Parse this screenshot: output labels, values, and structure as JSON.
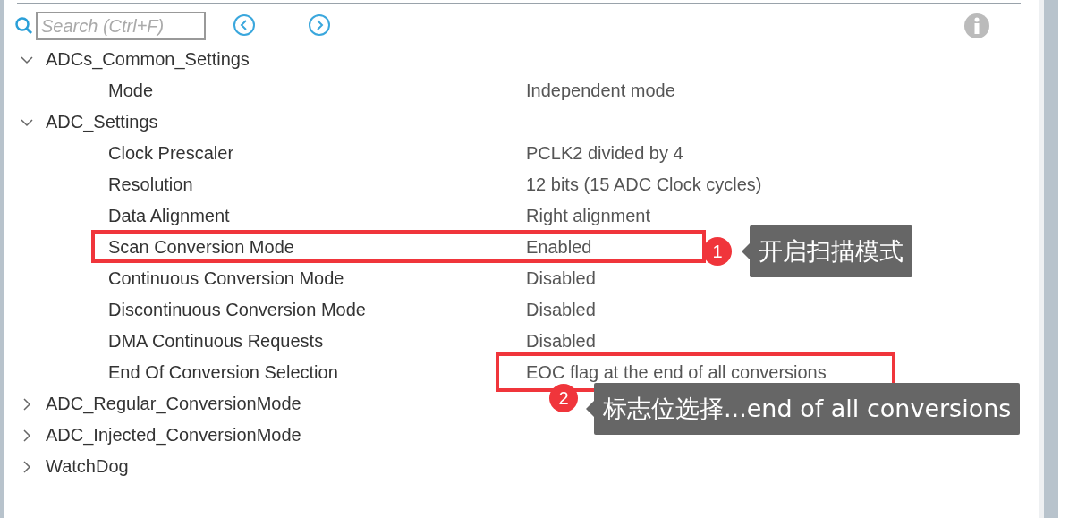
{
  "search": {
    "placeholder": "Search (Ctrl+F)"
  },
  "groups": [
    {
      "name": "ADCs_Common_Settings",
      "expanded": true,
      "children": [
        {
          "name": "Mode",
          "value": "Independent mode"
        }
      ]
    },
    {
      "name": "ADC_Settings",
      "expanded": true,
      "children": [
        {
          "name": "Clock Prescaler",
          "value": "PCLK2 divided by 4"
        },
        {
          "name": "Resolution",
          "value": "12 bits (15 ADC Clock cycles)"
        },
        {
          "name": "Data Alignment",
          "value": "Right alignment"
        },
        {
          "name": "Scan Conversion Mode",
          "value": "Enabled",
          "annotation": {
            "kind": "row",
            "number": "1",
            "note": "开启扫描模式"
          }
        },
        {
          "name": "Continuous Conversion Mode",
          "value": "Disabled"
        },
        {
          "name": "Discontinuous Conversion Mode",
          "value": "Disabled"
        },
        {
          "name": "DMA Continuous Requests",
          "value": "Disabled"
        },
        {
          "name": "End Of Conversion Selection",
          "value": "EOC flag at the end of all conversions",
          "annotation": {
            "kind": "value",
            "number": "2",
            "note": "标志位选择...end of all conversions"
          }
        }
      ]
    },
    {
      "name": "ADC_Regular_ConversionMode",
      "expanded": false
    },
    {
      "name": "ADC_Injected_ConversionMode",
      "expanded": false
    },
    {
      "name": "WatchDog",
      "expanded": false
    }
  ]
}
